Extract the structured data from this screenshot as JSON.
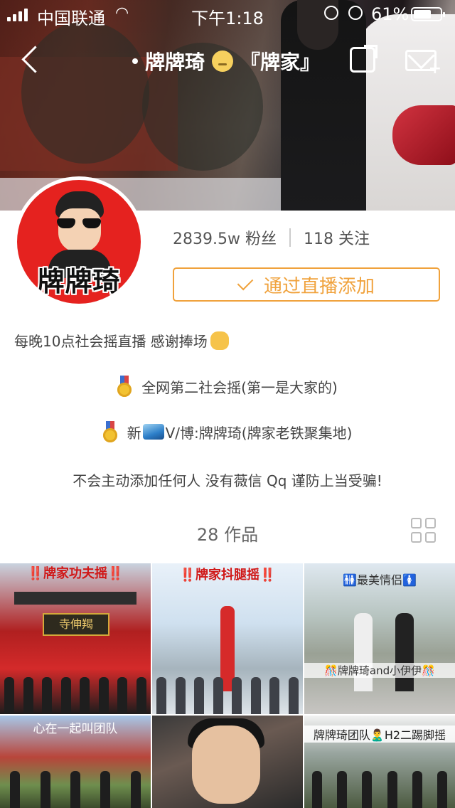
{
  "status_bar": {
    "carrier": "中国联通",
    "time": "下午1:18",
    "battery": "61%"
  },
  "nav": {
    "title_name": "牌牌琦",
    "title_suffix": "『牌家』"
  },
  "profile": {
    "avatar_text": "牌牌琦",
    "followers": "2839.5w 粉丝",
    "following": "118 关注",
    "add_button": "通过直播添加",
    "bio": {
      "line1": "每晚10点社会摇直播 感谢捧场",
      "line2": "全网第二社会摇(第一是大家的)",
      "line3_prefix": "新",
      "line3_suffix": "V/博:牌牌琦(牌家老铁聚集地)",
      "line4": "不会主动添加任何人 没有薇信 Qq 谨防上当受骗!"
    }
  },
  "works": {
    "label": "28 作品",
    "items": [
      {
        "caption": "‼️牌家功夫摇‼️"
      },
      {
        "caption": "‼️牌家抖腿摇‼️"
      },
      {
        "caption": "🚻最美情侣🚺"
      },
      {
        "caption": "心在一起叫团队"
      },
      {
        "caption": ""
      },
      {
        "caption": "牌牌琦团队🙎‍♂️H2二踢脚摇"
      }
    ],
    "overlay_text": "🎊牌牌琦and小伊伊🎊",
    "sign_text": "寺伸羯"
  }
}
